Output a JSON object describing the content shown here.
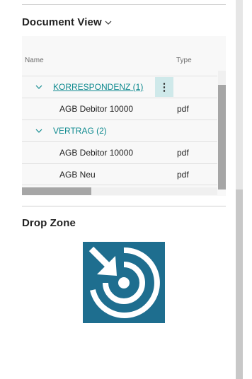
{
  "document_view": {
    "title": "Document View",
    "columns": {
      "name": "Name",
      "type": "Type"
    },
    "groups": [
      {
        "label": "KORRESPONDENZ (1)",
        "documents": [
          {
            "name": "AGB Debitor 10000",
            "type": "pdf"
          }
        ]
      },
      {
        "label": "VERTRAG (2)",
        "documents": [
          {
            "name": "AGB Debitor 10000",
            "type": "pdf"
          },
          {
            "name": "AGB Neu",
            "type": "pdf"
          }
        ]
      }
    ],
    "row_menu_glyph": "⋮"
  },
  "drop_zone": {
    "title": "Drop Zone",
    "icon": "drop-target-icon",
    "icon_bg": "#1e6e8f"
  },
  "colors": {
    "accent": "#0f8a8f",
    "selection": "#cfe9ea"
  }
}
